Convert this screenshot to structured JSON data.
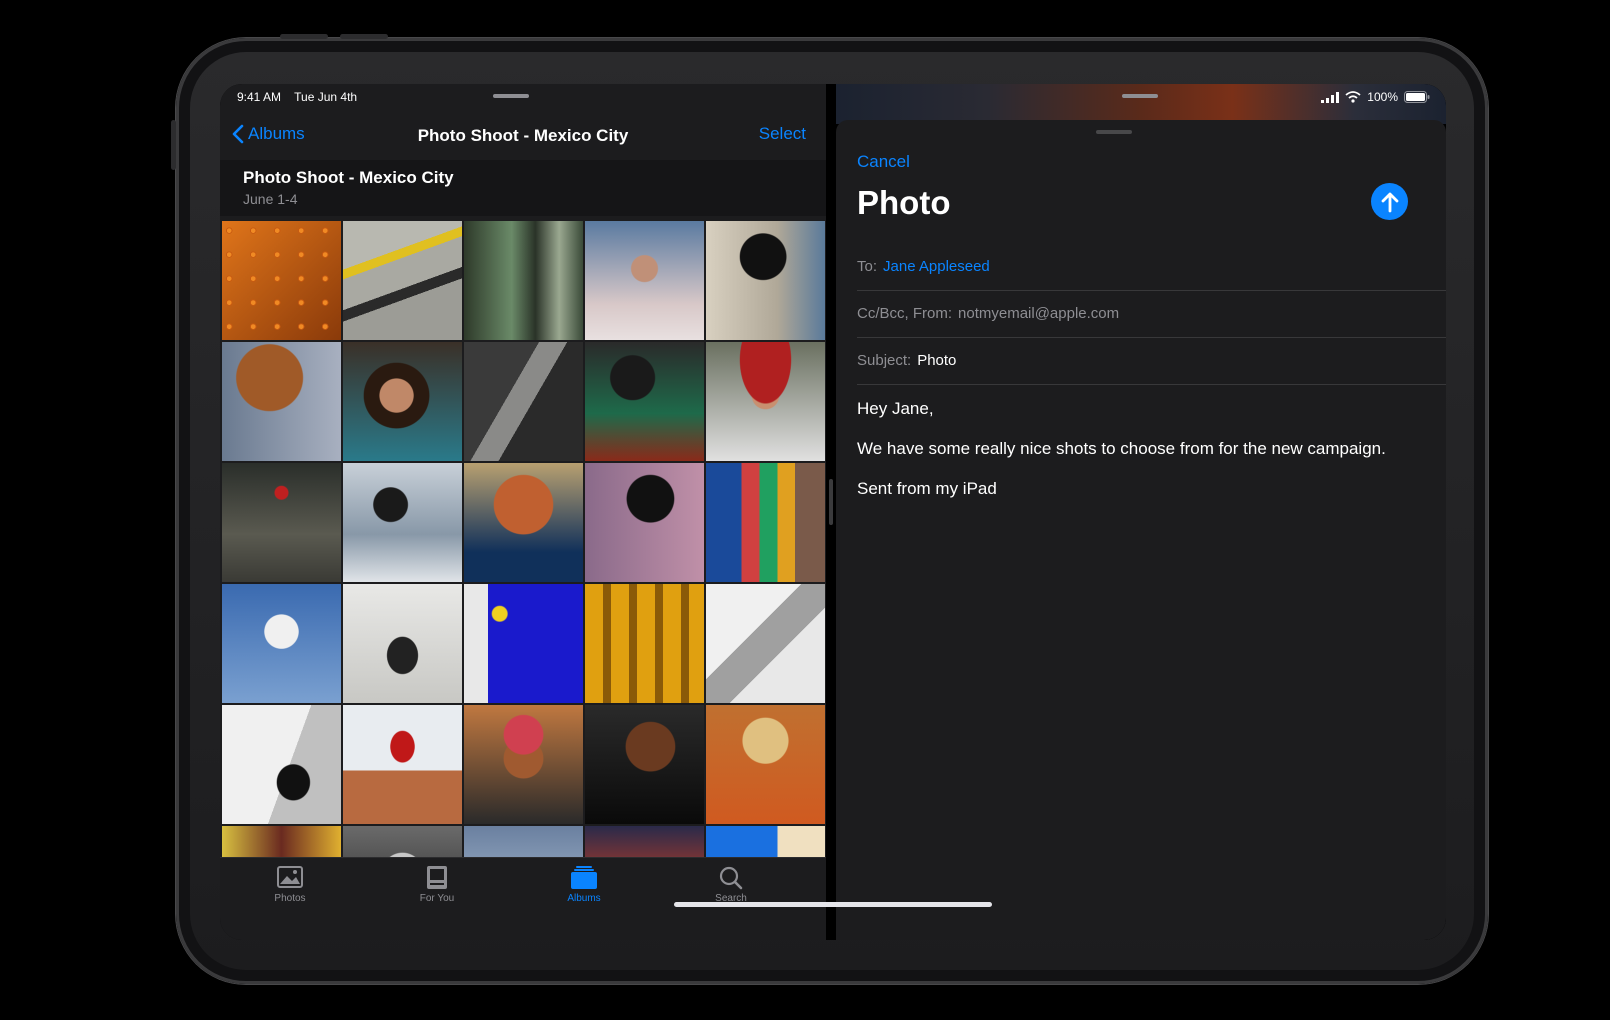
{
  "status_bar": {
    "time": "9:41 AM",
    "date": "Tue Jun 4th",
    "battery": "100%"
  },
  "photos_app": {
    "nav": {
      "back_label": "Albums",
      "title": "Photo Shoot - Mexico City",
      "select_label": "Select"
    },
    "album": {
      "title": "Photo Shoot - Mexico City",
      "subtitle": "June 1-4"
    },
    "tabs": [
      {
        "label": "Photos",
        "icon": "photos-icon"
      },
      {
        "label": "For You",
        "icon": "for-you-icon"
      },
      {
        "label": "Albums",
        "icon": "albums-icon",
        "active": true
      },
      {
        "label": "Search",
        "icon": "search-icon"
      }
    ]
  },
  "mail_app": {
    "cancel_label": "Cancel",
    "title": "Photo",
    "to_label": "To:",
    "to_value": "Jane Appleseed",
    "ccbcc_label": "Cc/Bcc, From:",
    "ccbcc_value": "notmyemail@apple.com",
    "subject_label": "Subject:",
    "subject_value": "Photo",
    "body": {
      "greeting": "Hey Jane,",
      "message": "We have some really nice shots to choose from for the new campaign.",
      "signature": "Sent from my iPad"
    }
  }
}
